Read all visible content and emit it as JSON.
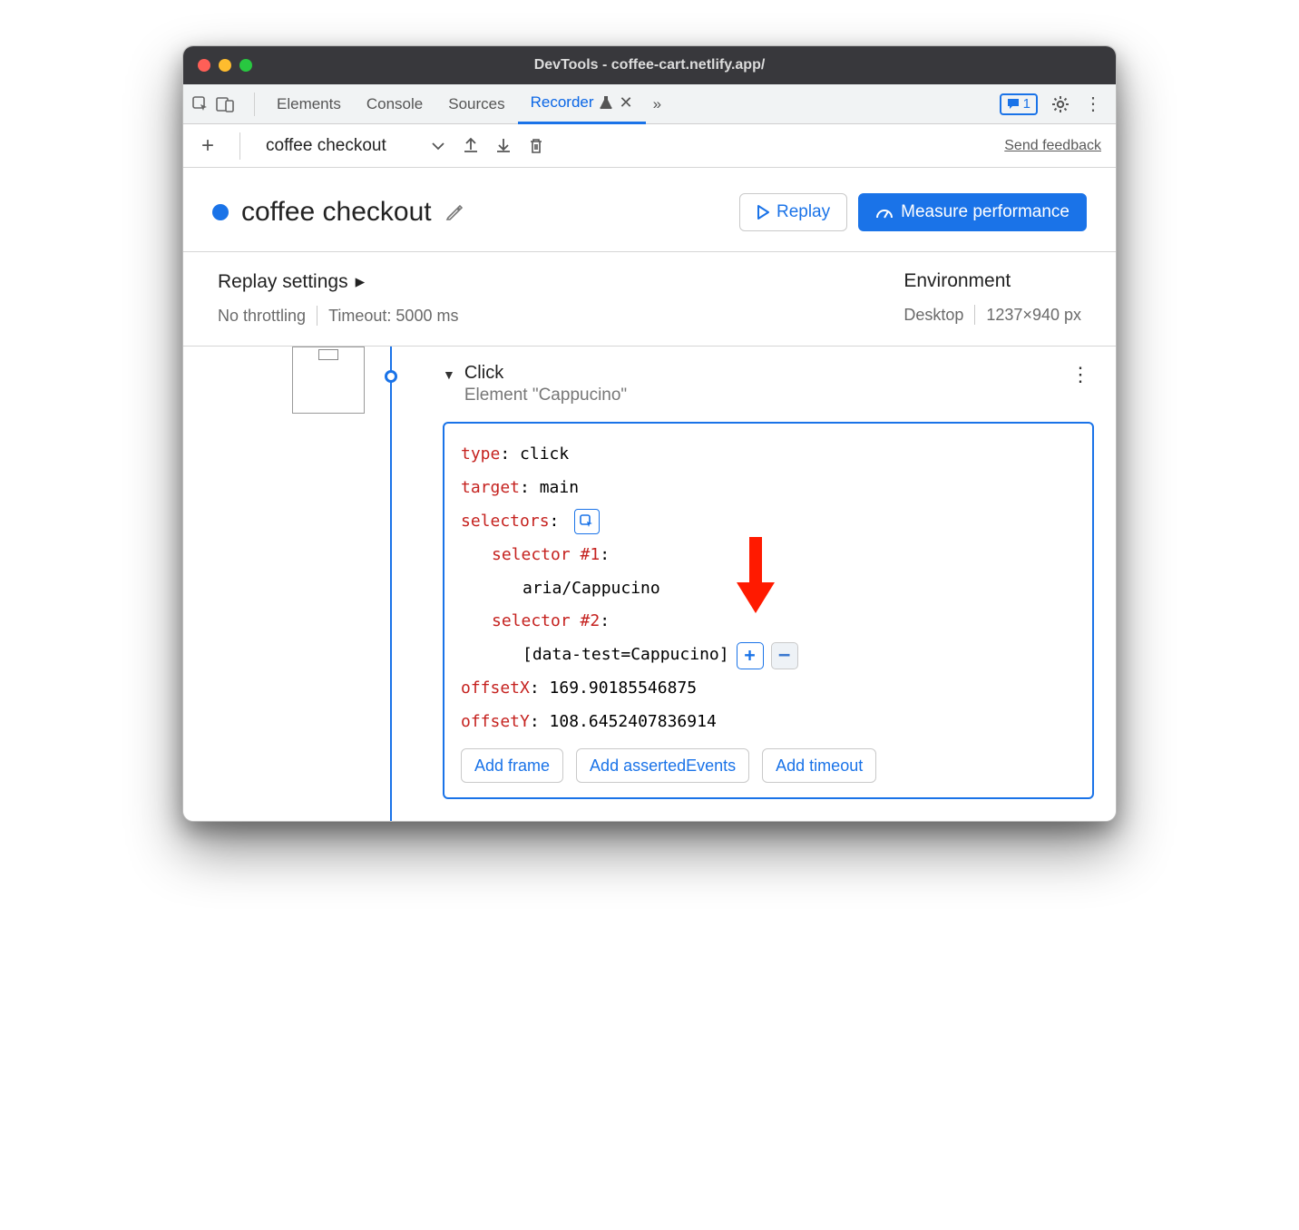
{
  "window": {
    "title": "DevTools - coffee-cart.netlify.app/"
  },
  "tabs": {
    "items": [
      "Elements",
      "Console",
      "Sources",
      "Recorder"
    ],
    "activeIndex": 3,
    "badgeCount": "1"
  },
  "toolbar": {
    "recordingName": "coffee checkout",
    "sendFeedback": "Send feedback"
  },
  "header": {
    "title": "coffee checkout",
    "replay": "Replay",
    "measure": "Measure performance"
  },
  "settings": {
    "replayTitle": "Replay settings",
    "throttling": "No throttling",
    "timeout": "Timeout: 5000 ms",
    "envTitle": "Environment",
    "device": "Desktop",
    "viewport": "1237×940 px"
  },
  "step": {
    "title": "Click",
    "subtitle": "Element \"Cappucino\"",
    "fields": {
      "typeKey": "type",
      "typeVal": "click",
      "targetKey": "target",
      "targetVal": "main",
      "selectorsKey": "selectors",
      "sel1Key": "selector #1",
      "sel1Val": "aria/Cappucino",
      "sel2Key": "selector #2",
      "sel2Val": "[data-test=Cappucino]",
      "offXKey": "offsetX",
      "offXVal": "169.90185546875",
      "offYKey": "offsetY",
      "offYVal": "108.6452407836914"
    },
    "actions": {
      "addFrame": "Add frame",
      "addAsserted": "Add assertedEvents",
      "addTimeout": "Add timeout"
    }
  }
}
